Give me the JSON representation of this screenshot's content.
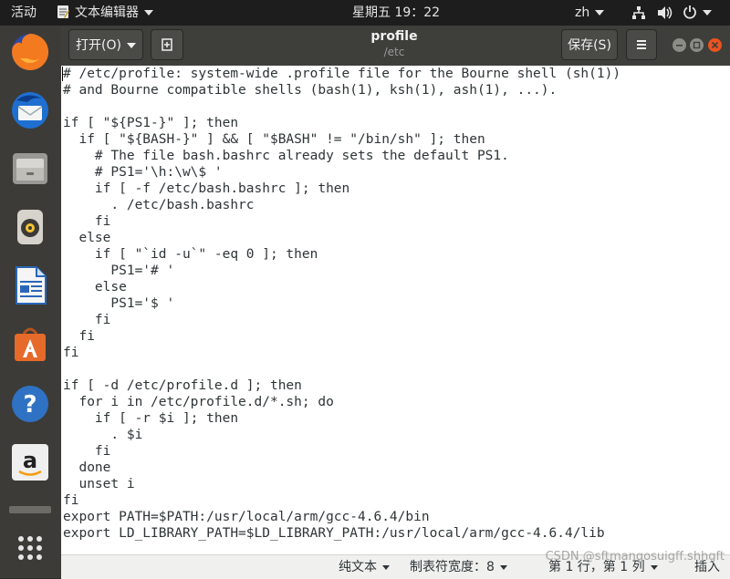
{
  "topbar": {
    "activities": "活动",
    "app_name": "文本编辑器",
    "clock": "星期五 19：22",
    "input_method": "zh"
  },
  "launcher": {
    "items": [
      "firefox-icon",
      "thunderbird-icon",
      "files-icon",
      "rhythmbox-icon",
      "libreoffice-writer-icon",
      "software-center-icon",
      "help-icon",
      "amazon-icon",
      "show-apps-icon"
    ]
  },
  "window": {
    "open_label": "打开(O)",
    "title": "profile",
    "subtitle": "/etc",
    "save_label": "保存(S)"
  },
  "editor": {
    "content": "# /etc/profile: system-wide .profile file for the Bourne shell (sh(1))\n# and Bourne compatible shells (bash(1), ksh(1), ash(1), ...).\n\nif [ \"${PS1-}\" ]; then\n  if [ \"${BASH-}\" ] && [ \"$BASH\" != \"/bin/sh\" ]; then\n    # The file bash.bashrc already sets the default PS1.\n    # PS1='\\h:\\w\\$ '\n    if [ -f /etc/bash.bashrc ]; then\n      . /etc/bash.bashrc\n    fi\n  else\n    if [ \"`id -u`\" -eq 0 ]; then\n      PS1='# '\n    else\n      PS1='$ '\n    fi\n  fi\nfi\n\nif [ -d /etc/profile.d ]; then\n  for i in /etc/profile.d/*.sh; do\n    if [ -r $i ]; then\n      . $i\n    fi\n  done\n  unset i\nfi\nexport PATH=$PATH:/usr/local/arm/gcc-4.6.4/bin\nexport LD_LIBRARY_PATH=$LD_LIBRARY_PATH:/usr/local/arm/gcc-4.6.4/lib"
  },
  "statusbar": {
    "language": "纯文本",
    "tab_width_label": "制表符宽度：8",
    "position": "第 1 行，第 1 列",
    "mode": "插入"
  },
  "watermark": "CSDN @sftmangosuigff.shhgft"
}
